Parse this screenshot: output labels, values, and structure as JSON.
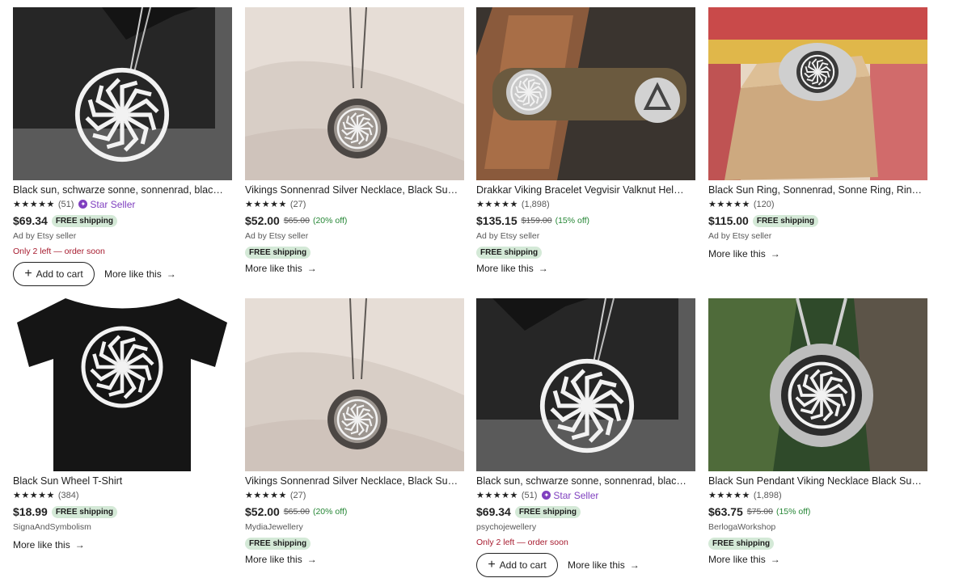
{
  "products": [
    {
      "title": "Black sun, schwarze sonne, sonnenrad, black s...",
      "stars": "★★★★★",
      "reviews": "(51)",
      "star_seller": "Star Seller",
      "price": "$69.34",
      "free_shipping": "FREE shipping",
      "meta": "Ad by Etsy seller",
      "urgency": "Only 2 left — order soon",
      "add_to_cart": "Add to cart",
      "more_like_this": "More like this"
    },
    {
      "title": "Vikings Sonnenrad Silver Necklace, Black Sun ...",
      "stars": "★★★★★",
      "reviews": "(27)",
      "price": "$52.00",
      "original_price": "$65.00",
      "discount": "(20% off)",
      "meta": "Ad by Etsy seller",
      "free_shipping": "FREE shipping",
      "more_like_this": "More like this"
    },
    {
      "title": "Drakkar Viking Bracelet Vegvisir Valknut Helm ...",
      "stars": "★★★★★",
      "reviews": "(1,898)",
      "price": "$135.15",
      "original_price": "$159.00",
      "discount": "(15% off)",
      "meta": "Ad by Etsy seller",
      "free_shipping": "FREE shipping",
      "more_like_this": "More like this"
    },
    {
      "title": "Black Sun Ring, Sonnenrad, Sonne Ring, Ring ...",
      "stars": "★★★★★",
      "reviews": "(120)",
      "price": "$115.00",
      "free_shipping": "FREE shipping",
      "meta": "Ad by Etsy seller",
      "more_like_this": "More like this"
    },
    {
      "title": "Black Sun Wheel T-Shirt",
      "stars": "★★★★★",
      "reviews": "(384)",
      "price": "$18.99",
      "free_shipping": "FREE shipping",
      "meta": "SignaAndSymbolism",
      "more_like_this": "More like this"
    },
    {
      "title": "Vikings Sonnenrad Silver Necklace, Black Sun ...",
      "stars": "★★★★★",
      "reviews": "(27)",
      "price": "$52.00",
      "original_price": "$65.00",
      "discount": "(20% off)",
      "meta": "MydiaJewellery",
      "free_shipping": "FREE shipping",
      "more_like_this": "More like this"
    },
    {
      "title": "Black sun, schwarze sonne, sonnenrad, black s...",
      "stars": "★★★★★",
      "reviews": "(51)",
      "star_seller": "Star Seller",
      "price": "$69.34",
      "free_shipping": "FREE shipping",
      "meta": "psychojewellery",
      "urgency": "Only 2 left — order soon",
      "add_to_cart": "Add to cart",
      "more_like_this": "More like this"
    },
    {
      "title": "Black Sun Pendant Viking Necklace Black Sun ...",
      "stars": "★★★★★",
      "reviews": "(1,898)",
      "price": "$63.75",
      "original_price": "$75.00",
      "discount": "(15% off)",
      "meta": "BerlogaWorkshop",
      "free_shipping": "FREE shipping",
      "more_like_this": "More like this"
    }
  ],
  "colors": {
    "star_seller": "#7f3fbf",
    "discount_green": "#258635",
    "free_shipping_bg": "#d4e9d7",
    "urgency_red": "#a61a2e"
  }
}
